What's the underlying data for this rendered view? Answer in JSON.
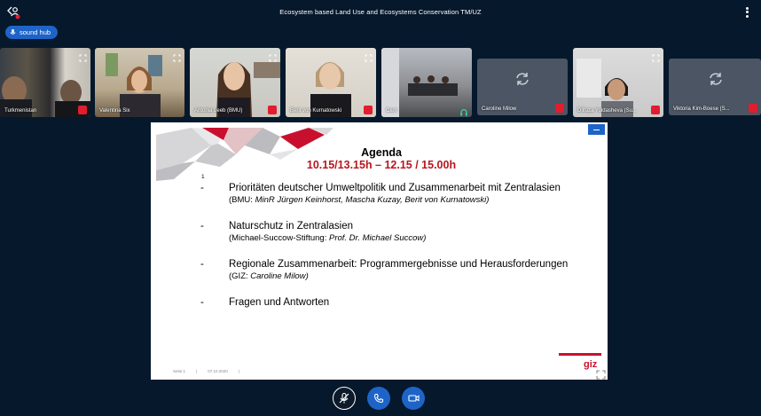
{
  "window": {
    "title": "Ecosystem based Land Use and Ecosystems Conservation TM/UZ"
  },
  "badge": {
    "label": "sound hub"
  },
  "participants": [
    {
      "name": "Turkmenistan",
      "video": true,
      "muted": true
    },
    {
      "name": "Valentina Six",
      "video": true,
      "muted": false
    },
    {
      "name": "Antonia Leeb (BMU)",
      "video": true,
      "muted": true
    },
    {
      "name": "Berit von Kurnatowski",
      "video": true,
      "muted": true
    },
    {
      "name": "Cam",
      "video": true,
      "muted": false
    },
    {
      "name": "Caroline Milow",
      "video": false,
      "muted": true
    },
    {
      "name": "Dilfuza Yuldasheva (Su...",
      "video": true,
      "muted": true
    },
    {
      "name": "Viktoria Kim-Boese (S...",
      "video": false,
      "muted": true
    }
  ],
  "slide": {
    "title": "Agenda",
    "time": "10.15/13.15h – 12.15 / 15.00h",
    "number": "1",
    "items": [
      {
        "dash": "-",
        "main": "Prioritäten deutscher Umweltpolitik und Zusammenarbeit mit Zentralasien",
        "sub_prefix": "(BMU: ",
        "sub_italic": "MinR Jürgen Keinhorst, Mascha  Kuzay, Berit von Kurnatowski)",
        "sub_suffix": ""
      },
      {
        "dash": "-",
        "main": "Naturschutz in Zentralasien",
        "sub_prefix": "(Michael-Succow-Stiftung: ",
        "sub_italic": "Prof. Dr. Michael Succow)",
        "sub_suffix": ""
      },
      {
        "dash": "-",
        "main": "Regionale Zusammenarbeit: Programmergebnisse und Herausforderungen",
        "sub_prefix": "(GIZ: ",
        "sub_italic": "Caroline Milow)",
        "sub_suffix": ""
      },
      {
        "dash": "-",
        "main": "Fragen und Antworten",
        "sub_prefix": "",
        "sub_italic": "",
        "sub_suffix": ""
      }
    ],
    "footer_page": "Seite 1",
    "footer_sep1": "|",
    "footer_date": "07.10.2020",
    "footer_sep2": "|",
    "logo_text": "giz"
  },
  "colors": {
    "accent": "#1e64c8",
    "background": "#06182c",
    "muted_red": "#e11d2e",
    "slide_red": "#b8161e"
  },
  "icons": [
    "user-icon",
    "menu-icon",
    "microphone-icon",
    "expand-icon",
    "sync-icon",
    "mute-icon",
    "phone-icon",
    "camera-icon",
    "headset-icon"
  ]
}
